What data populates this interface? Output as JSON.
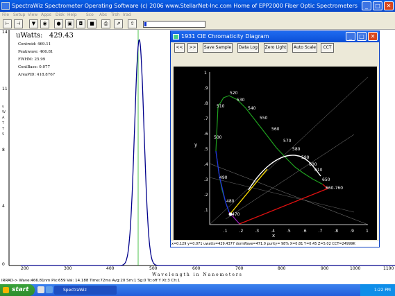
{
  "app": {
    "title": "SpectraWiz  Spectrometer Operating Software (c) 2006  www.StellarNet-Inc.com  Home of EPP2000 Fiber Optic Spectrometers"
  },
  "menu": [
    "File",
    "Setup",
    "View",
    "Apps",
    "Disk",
    "Help",
    "Sco",
    "Abs",
    "Trsh",
    "Irad"
  ],
  "main_plot": {
    "y_unit_vertical": "uWATTS",
    "y_ticks": [
      "14",
      "11",
      "8",
      "4",
      "0"
    ],
    "x_ticks": [
      "200",
      "300",
      "400",
      "500",
      "600",
      "700",
      "800",
      "900",
      "1000",
      "1100"
    ],
    "x_title": "Wavelength in Nanometers"
  },
  "readouts": {
    "uwatts_label": "uWatts:",
    "uwatts_value": "429.43",
    "centroid": "Centroid:  469.11",
    "peakwave": "Peakwave: 466.81",
    "fwhm": "FWHM:     25.99",
    "centbase": "CentBase:  0.077",
    "areapid": "AreaPID:   418.8767"
  },
  "status_bar": "IRRAD-> Wave:466.81nm  Pix:659  Val: 14.188  Time:72ms  Avg:20  Sm:1  Sg:0  Tc:off  Y  Xt:3  Ch:1",
  "taskbar": {
    "start": "start",
    "task": "SpectraWiz",
    "clock": "1:22 PM"
  },
  "cie": {
    "title": "1931 CIE Chromaticity Diagram",
    "buttons": [
      "<<",
      ">>",
      "Save Sample",
      "Data Log",
      "Zero Light",
      "Auto Scale",
      "CCT"
    ],
    "y_axis_label": "y",
    "x_axis_label": "x",
    "axis_ticks": [
      ".1",
      ".2",
      ".3",
      ".4",
      ".5",
      ".6",
      ".7",
      ".8",
      ".9",
      "1"
    ],
    "y_ticks_left": [
      "1",
      ".9",
      ".8",
      ".7",
      ".6",
      ".5",
      ".4",
      ".3",
      ".2",
      ".1"
    ],
    "wavelength_labels": [
      "520",
      "530",
      "540",
      "550",
      "560",
      "570",
      "580",
      "590",
      "600",
      "610",
      "650",
      "660-760",
      "510",
      "500",
      "490",
      "480",
      "470"
    ],
    "status": "x=0.129 y=0.071  uwatts=429.4377  domWave=471.0  purity= 98%  X=0.81  Y=0.45  Z=5.02  CCT=24999K",
    "colors": {
      "accent": "#0a4ed6",
      "locus_green": "#1f9f1f",
      "locus_red": "#e01010",
      "locus_blue": "#2030e0",
      "white": "#ffffff"
    }
  }
}
